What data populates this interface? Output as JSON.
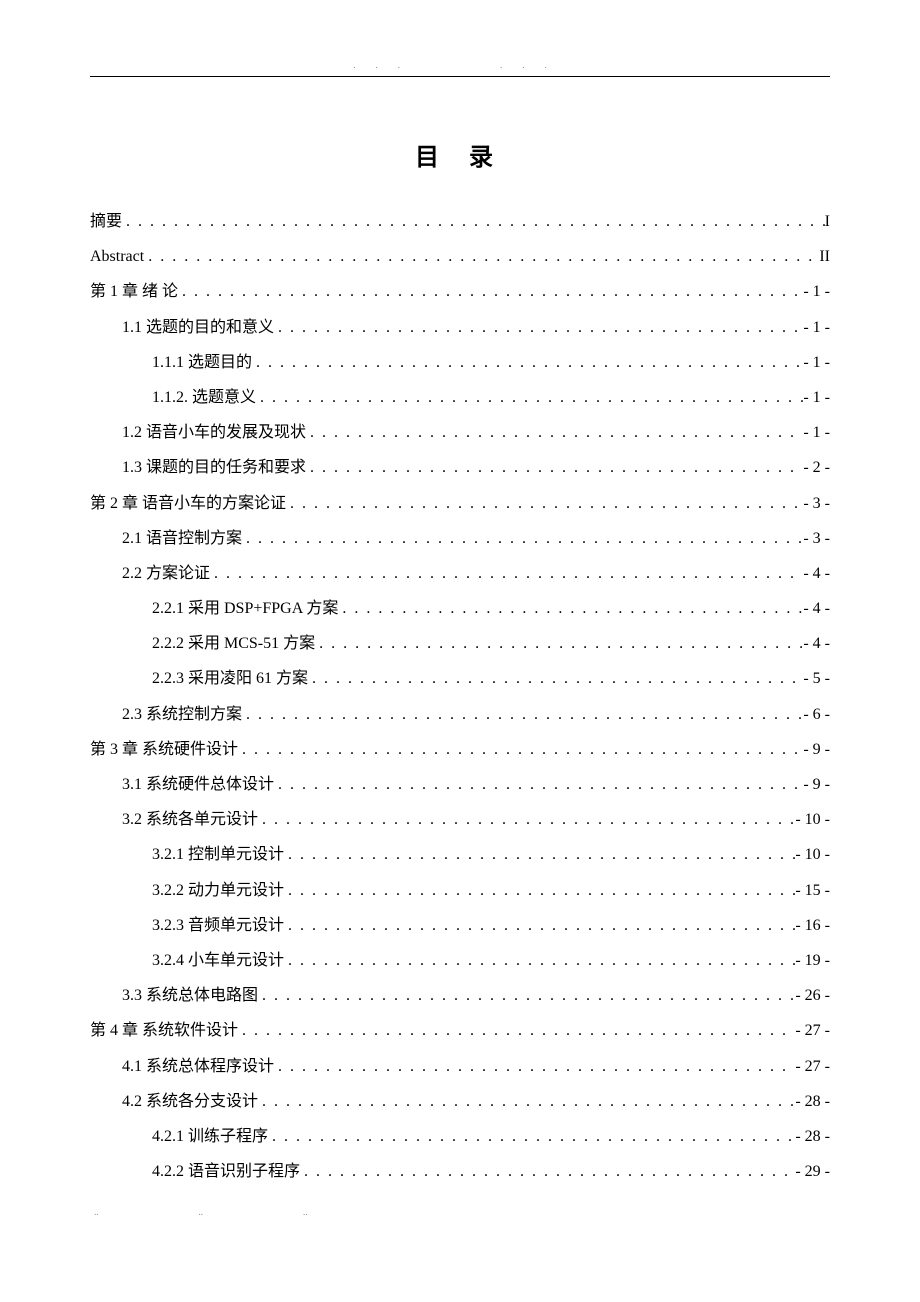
{
  "title": "目 录",
  "entries": [
    {
      "level": 0,
      "label": "摘要",
      "page": "I"
    },
    {
      "level": 0,
      "label": "Abstract",
      "page": "II"
    },
    {
      "level": 0,
      "label": "第 1 章 绪  论",
      "page": "- 1 -"
    },
    {
      "level": 1,
      "label": "1.1  选题的目的和意义",
      "page": "- 1 -"
    },
    {
      "level": 2,
      "label": "1.1.1 选题目的",
      "page": "- 1 -"
    },
    {
      "level": 2,
      "label": "1.1.2. 选题意义",
      "page": "- 1 -"
    },
    {
      "level": 1,
      "label": "1.2  语音小车的发展及现状",
      "page": "- 1 -"
    },
    {
      "level": 1,
      "label": "1.3  课题的目的任务和要求",
      "page": "- 2 -"
    },
    {
      "level": 0,
      "label": "第 2 章 语音小车的方案论证",
      "page": "- 3 -"
    },
    {
      "level": 1,
      "label": "2.1  语音控制方案",
      "page": "- 3 -"
    },
    {
      "level": 1,
      "label": "2.2  方案论证",
      "page": "- 4 -"
    },
    {
      "level": 2,
      "label": "2.2.1 采用 DSP+FPGA 方案",
      "page": "- 4 -"
    },
    {
      "level": 2,
      "label": "2.2.2 采用 MCS-51 方案",
      "page": "- 4 -"
    },
    {
      "level": 2,
      "label": "2.2.3 采用凌阳 61 方案",
      "page": "- 5 -"
    },
    {
      "level": 1,
      "label": "2.3  系统控制方案",
      "page": "- 6 -"
    },
    {
      "level": 0,
      "label": "第 3 章 系统硬件设计",
      "page": "- 9 -"
    },
    {
      "level": 1,
      "label": "3.1  系统硬件总体设计",
      "page": "- 9 -"
    },
    {
      "level": 1,
      "label": "3.2  系统各单元设计",
      "page": "- 10 -"
    },
    {
      "level": 2,
      "label": "3.2.1  控制单元设计",
      "page": "- 10 -"
    },
    {
      "level": 2,
      "label": "3.2.2  动力单元设计",
      "page": "- 15 -"
    },
    {
      "level": 2,
      "label": "3.2.3  音频单元设计",
      "page": "- 16 -"
    },
    {
      "level": 2,
      "label": "3.2.4  小车单元设计",
      "page": "- 19 -"
    },
    {
      "level": 1,
      "label": "3.3  系统总体电路图",
      "page": "- 26 -"
    },
    {
      "level": 0,
      "label": "第 4 章 系统软件设计",
      "page": "- 27 -"
    },
    {
      "level": 1,
      "label": "4.1  系统总体程序设计",
      "page": "- 27 -"
    },
    {
      "level": 1,
      "label": "4.2  系统各分支设计",
      "page": "- 28 -"
    },
    {
      "level": 2,
      "label": "4.2.1 训练子程序",
      "page": "- 28 -"
    },
    {
      "level": 2,
      "label": "4.2.2 语音识别子程序",
      "page": "- 29 -"
    }
  ]
}
